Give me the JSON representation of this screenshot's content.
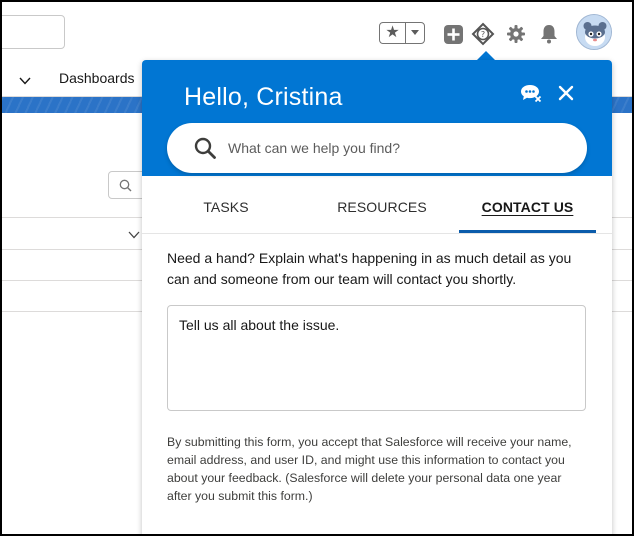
{
  "header": {
    "favorites_icon": "star-icon",
    "icons": [
      "add-icon",
      "help-icon",
      "gear-icon",
      "bell-icon",
      "avatar"
    ]
  },
  "nav": {
    "dashboards_label": "Dashboards"
  },
  "help_panel": {
    "greeting": "Hello, Cristina",
    "search": {
      "placeholder": "What can we help you find?"
    },
    "tabs": [
      {
        "label": "TASKS",
        "active": false
      },
      {
        "label": "RESOURCES",
        "active": false
      },
      {
        "label": "CONTACT US",
        "active": true
      }
    ],
    "contact": {
      "intro": "Need a hand? Explain what's happening in as much detail as you can and someone from our team will contact you shortly.",
      "issue_placeholder": "Tell us all about the issue.",
      "disclaimer": "By submitting this form, you accept that Salesforce will receive your name, email address, and user ID, and might use this information to contact you about your feedback. (Salesforce will delete your personal data one year after you submit this form.)"
    }
  },
  "colors": {
    "brand_blue": "#0176d3",
    "active_tab_underline": "#0b5cab",
    "band_blue": "#2b73c7"
  }
}
